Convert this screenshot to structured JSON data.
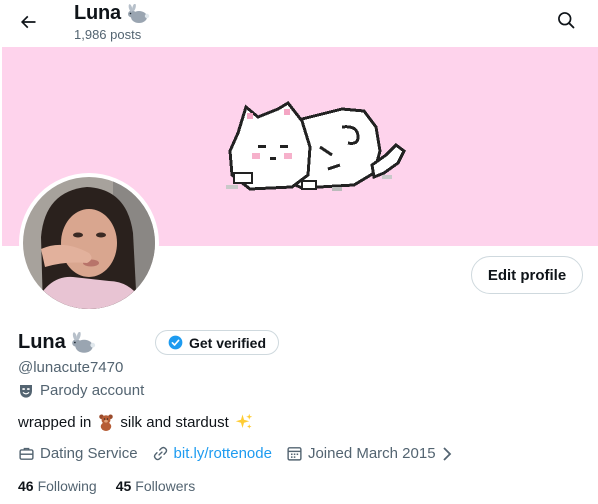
{
  "header": {
    "name": "Luna",
    "posts_count": "1,986 posts"
  },
  "profile": {
    "display_name": "Luna",
    "handle": "@lunacute7470",
    "label": "Parody account",
    "bio_before": "wrapped in",
    "bio_after": "silk and stardust",
    "category": "Dating Service",
    "link": "bit.ly/rottenode",
    "joined": "Joined March 2015"
  },
  "buttons": {
    "edit_profile": "Edit profile",
    "get_verified": "Get verified"
  },
  "stats": {
    "following_count": "46",
    "following_label": "Following",
    "followers_count": "45",
    "followers_label": "Followers"
  },
  "icons": {
    "back": "arrow-left-icon",
    "search": "search-icon",
    "rabbit": "rabbit-emoji-icon",
    "verified": "verified-badge-icon",
    "parody": "theater-mask-icon",
    "teddy": "teddy-bear-emoji-icon",
    "sparkles": "sparkles-emoji-icon",
    "briefcase": "briefcase-icon",
    "link": "link-icon",
    "calendar": "calendar-icon",
    "chevron": "chevron-right-icon"
  },
  "colors": {
    "accent": "#1d9bf0",
    "banner": "#fed3ec",
    "secondary_text": "#536471",
    "primary_text": "#0f1419"
  }
}
